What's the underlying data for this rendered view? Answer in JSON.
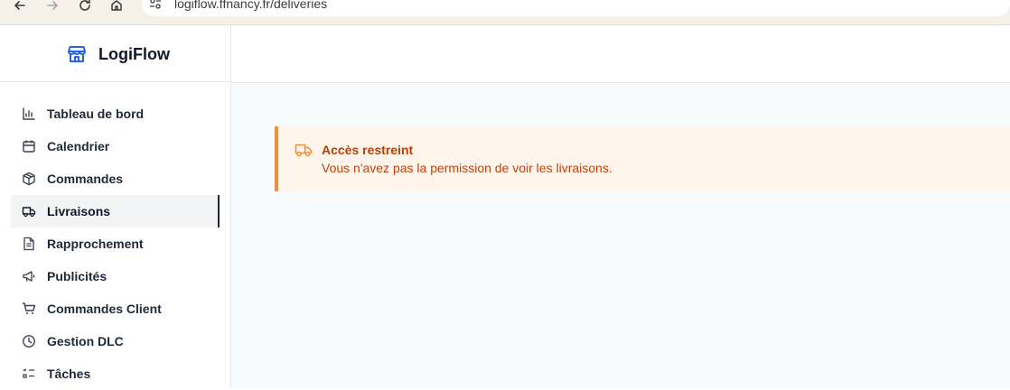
{
  "browser": {
    "url": "logiflow.ffnancy.fr/deliveries"
  },
  "app": {
    "name": "LogiFlow"
  },
  "sidebar": {
    "items": [
      {
        "label": "Tableau de bord",
        "icon": "bar-chart-icon"
      },
      {
        "label": "Calendrier",
        "icon": "calendar-icon"
      },
      {
        "label": "Commandes",
        "icon": "package-icon"
      },
      {
        "label": "Livraisons",
        "icon": "truck-icon",
        "active": true
      },
      {
        "label": "Rapprochement",
        "icon": "file-text-icon"
      },
      {
        "label": "Publicités",
        "icon": "megaphone-icon"
      },
      {
        "label": "Commandes Client",
        "icon": "cart-icon"
      },
      {
        "label": "Gestion DLC",
        "icon": "clock-icon"
      },
      {
        "label": "Tâches",
        "icon": "list-checks-icon"
      }
    ]
  },
  "alert": {
    "title": "Accès restreint",
    "message": "Vous n'avez pas la permission de voir les livraisons.",
    "icon": "truck-icon"
  },
  "colors": {
    "alert_bg": "#fff5eb",
    "alert_border": "#f0903a",
    "alert_text": "#c2410c",
    "brand_blue": "#2563eb"
  }
}
